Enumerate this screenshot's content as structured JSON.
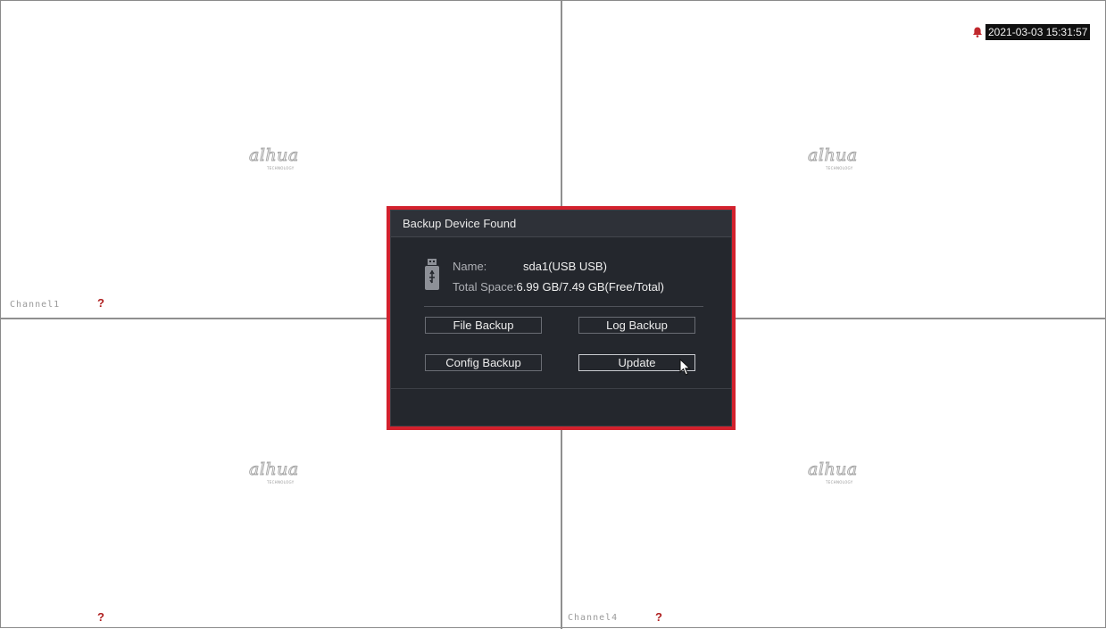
{
  "clock": {
    "datetime": "2021-03-03 15:31:57",
    "alarm_icon": "bell-icon"
  },
  "channels": [
    {
      "label": "Channel1",
      "status_icon": "question-mark-icon"
    },
    {
      "label": "",
      "status_icon": ""
    },
    {
      "label": "",
      "status_icon": "question-mark-icon"
    },
    {
      "label": "Channel4",
      "status_icon": "question-mark-icon"
    }
  ],
  "logo": {
    "brand": "alhua",
    "tagline": "TECHNOLOGY"
  },
  "dialog": {
    "title": "Backup Device Found",
    "device_icon": "usb-drive-icon",
    "name_label": "Name:",
    "name_value": "sda1(USB USB)",
    "space_label": "Total Space:",
    "space_value": "6.99 GB/7.49 GB(Free/Total)",
    "buttons": {
      "file_backup": "File Backup",
      "log_backup": "Log Backup",
      "config_backup": "Config Backup",
      "update": "Update"
    }
  },
  "colors": {
    "highlight_border": "#d3212d",
    "dialog_bg": "#24272d",
    "alarm": "#c0282d"
  }
}
